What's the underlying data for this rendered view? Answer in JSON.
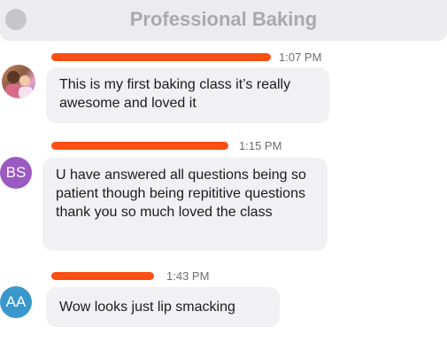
{
  "header": {
    "title": "Professional Baking"
  },
  "messages": [
    {
      "time": "1:07 PM",
      "avatar_initials": "",
      "avatar_color": "",
      "text": "This is my first baking class it’s really awesome and loved it"
    },
    {
      "time": "1:15 PM",
      "avatar_initials": "BS",
      "avatar_color": "#9b59c2",
      "text": "U have answered all questions being so patient though being repititive questions thank you so much loved the class"
    },
    {
      "time": "1:43 PM",
      "avatar_initials": "AA",
      "avatar_color": "#3a97cc",
      "text": "Wow looks just lip smacking"
    }
  ],
  "colors": {
    "redaction": "#fb4f14",
    "bubble": "#f1f1f3",
    "header": "#ececee"
  }
}
